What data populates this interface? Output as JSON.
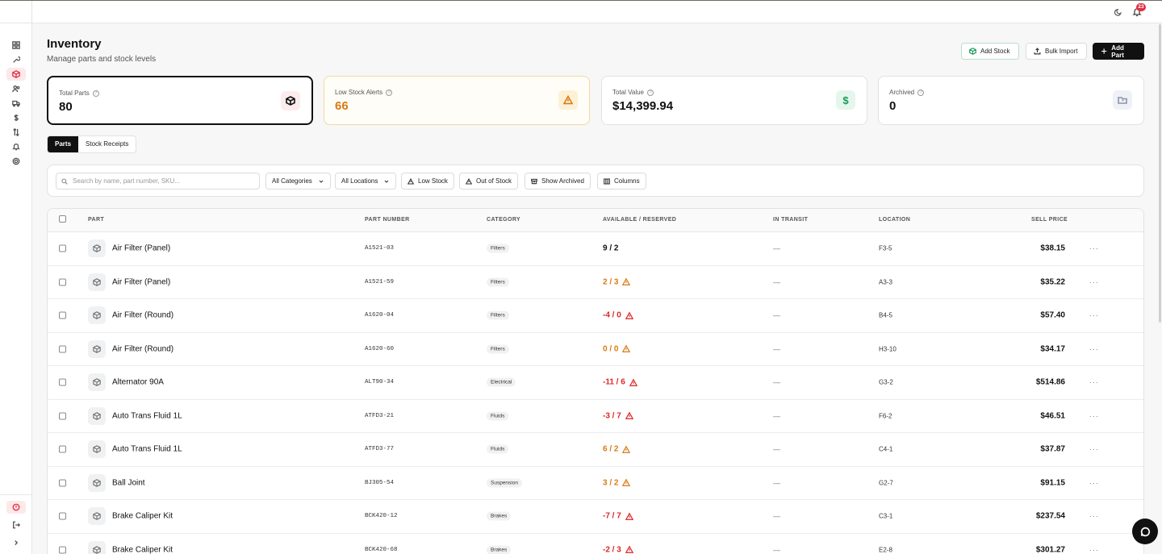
{
  "header": {
    "notification_count": "23"
  },
  "page": {
    "title": "Inventory",
    "subtitle": "Manage parts and stock levels"
  },
  "actions": {
    "add_stock": "Add Stock",
    "bulk_import": "Bulk Import",
    "add_part": "Add Part"
  },
  "stats": [
    {
      "label": "Total Parts",
      "value": "80",
      "icon": "box-icon"
    },
    {
      "label": "Low Stock Alerts",
      "value": "66",
      "icon": "warning-icon"
    },
    {
      "label": "Total Value",
      "value": "$14,399.94",
      "icon": "dollar-icon"
    },
    {
      "label": "Archived",
      "value": "0",
      "icon": "archive-folder-icon"
    }
  ],
  "stat_value_symbol": "$",
  "tabs": [
    {
      "label": "Parts",
      "active": true
    },
    {
      "label": "Stock Receipts",
      "active": false
    }
  ],
  "filters": {
    "search_placeholder": "Search by name, part number, SKU...",
    "category": "All Categories",
    "location": "All Locations",
    "low_stock": "Low Stock",
    "out_of_stock": "Out of Stock",
    "show_archived": "Show Archived",
    "columns": "Columns"
  },
  "table": {
    "headers": {
      "part": "PART",
      "part_number": "PART NUMBER",
      "category": "CATEGORY",
      "available": "AVAILABLE / RESERVED",
      "in_transit": "IN TRANSIT",
      "location": "LOCATION",
      "sell_price": "SELL PRICE"
    },
    "more_label": "···",
    "rows": [
      {
        "name": "Air Filter (Panel)",
        "part_number": "A1521-03",
        "category": "Filters",
        "available": "9 / 2",
        "status": "ok",
        "in_transit": "—",
        "location": "F3-5",
        "price": "$38.15"
      },
      {
        "name": "Air Filter (Panel)",
        "part_number": "A1521-59",
        "category": "Filters",
        "available": "2 / 3",
        "status": "low",
        "in_transit": "—",
        "location": "A3-3",
        "price": "$35.22"
      },
      {
        "name": "Air Filter (Round)",
        "part_number": "A1620-04",
        "category": "Filters",
        "available": "-4 / 0",
        "status": "negative",
        "in_transit": "—",
        "location": "B4-5",
        "price": "$57.40"
      },
      {
        "name": "Air Filter (Round)",
        "part_number": "A1620-60",
        "category": "Filters",
        "available": "0 / 0",
        "status": "low",
        "in_transit": "—",
        "location": "H3-10",
        "price": "$34.17"
      },
      {
        "name": "Alternator 90A",
        "part_number": "ALT90-34",
        "category": "Electrical",
        "available": "-11 / 6",
        "status": "negative",
        "in_transit": "—",
        "location": "G3-2",
        "price": "$514.86"
      },
      {
        "name": "Auto Trans Fluid 1L",
        "part_number": "ATFD3-21",
        "category": "Fluids",
        "available": "-3 / 7",
        "status": "negative",
        "in_transit": "—",
        "location": "F6-2",
        "price": "$46.51"
      },
      {
        "name": "Auto Trans Fluid 1L",
        "part_number": "ATFD3-77",
        "category": "Fluids",
        "available": "6 / 2",
        "status": "low",
        "in_transit": "—",
        "location": "C4-1",
        "price": "$37.87"
      },
      {
        "name": "Ball Joint",
        "part_number": "BJ305-54",
        "category": "Suspension",
        "available": "3 / 2",
        "status": "low",
        "in_transit": "—",
        "location": "G2-7",
        "price": "$91.15"
      },
      {
        "name": "Brake Caliper Kit",
        "part_number": "BCK420-12",
        "category": "Brakes",
        "available": "-7 / 7",
        "status": "negative",
        "in_transit": "—",
        "location": "C3-1",
        "price": "$237.54"
      },
      {
        "name": "Brake Caliper Kit",
        "part_number": "BCK420-68",
        "category": "Brakes",
        "available": "-2 / 3",
        "status": "negative",
        "in_transit": "—",
        "location": "E2-8",
        "price": "$301.27"
      }
    ]
  },
  "colors": {
    "accent": "#e03142",
    "ok": "#111111",
    "low": "#d97a14",
    "negative": "#dc2626",
    "green": "#1a9a5a"
  }
}
